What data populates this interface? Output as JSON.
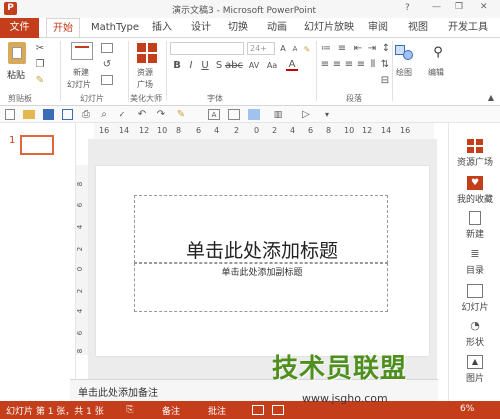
{
  "window": {
    "title": "演示文稿3 - Microsoft PowerPoint",
    "help": "?",
    "minimize": "—",
    "restore": "❐",
    "close": "✕"
  },
  "tabs": [
    "文件",
    "开始",
    "MathType",
    "插入",
    "设计",
    "切换",
    "动画",
    "幻灯片放映",
    "审阅",
    "视图",
    "开发工具"
  ],
  "ribbon": {
    "groups": [
      "剪贴板",
      "幻灯片",
      "美化大师",
      "字体",
      "段落"
    ],
    "paste": "粘贴",
    "new_slide": "新建",
    "new_slide2": "幻灯片",
    "resources": "资源",
    "resources2": "广场",
    "font_size": "24+",
    "drawing": "绘图",
    "editing": "编辑"
  },
  "ruler": {
    "h": [
      "16",
      "14",
      "12",
      "10",
      "8",
      "6",
      "4",
      "2",
      "0",
      "2",
      "4",
      "6",
      "8",
      "10",
      "12",
      "14",
      "16"
    ],
    "v": [
      "8",
      "6",
      "4",
      "2",
      "0",
      "2",
      "4",
      "6",
      "8"
    ]
  },
  "thumbs": {
    "number": "1"
  },
  "slide": {
    "title_placeholder": "单击此处添加标题",
    "subtitle_placeholder": "单击此处添加副标题"
  },
  "notes": {
    "placeholder": "单击此处添加备注"
  },
  "taskpane": {
    "items": [
      "资源广场",
      "我的收藏",
      "新建",
      "目录",
      "幻灯片",
      "形状",
      "图片"
    ]
  },
  "status": {
    "slide_info": "幻灯片 第 1 张，共 1 张",
    "notes": "备注",
    "comments": "批注",
    "zoom": "6%"
  },
  "watermark": {
    "brand": "技术员联盟",
    "url": "www.jsgho.com"
  },
  "colors": {
    "accent": "#c43e1c",
    "tab_active": "#c43e1c"
  }
}
